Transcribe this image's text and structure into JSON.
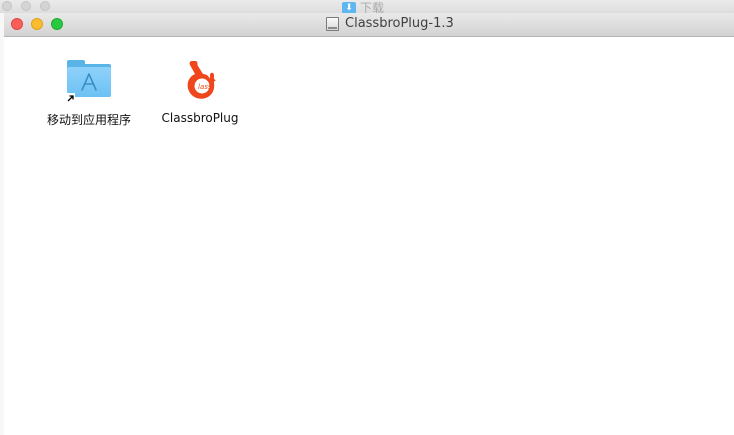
{
  "background_window": {
    "title": "下载",
    "title_icon": "download-folder-icon"
  },
  "window": {
    "title": "ClassbroPlug-1.3",
    "title_icon": "disk-image-icon",
    "controls": {
      "close": "close-icon",
      "minimize": "minimize-icon",
      "zoom": "zoom-icon"
    }
  },
  "items": [
    {
      "label": "移动到应用程序",
      "icon": "applications-folder-alias-icon"
    },
    {
      "label": "ClassbroPlug",
      "icon": "classbro-app-icon"
    }
  ],
  "colors": {
    "close": "#fc5f57",
    "minimize": "#fdbc2e",
    "zoom": "#28c840",
    "folder": "#6cc1f3",
    "app_accent": "#f0461c"
  }
}
